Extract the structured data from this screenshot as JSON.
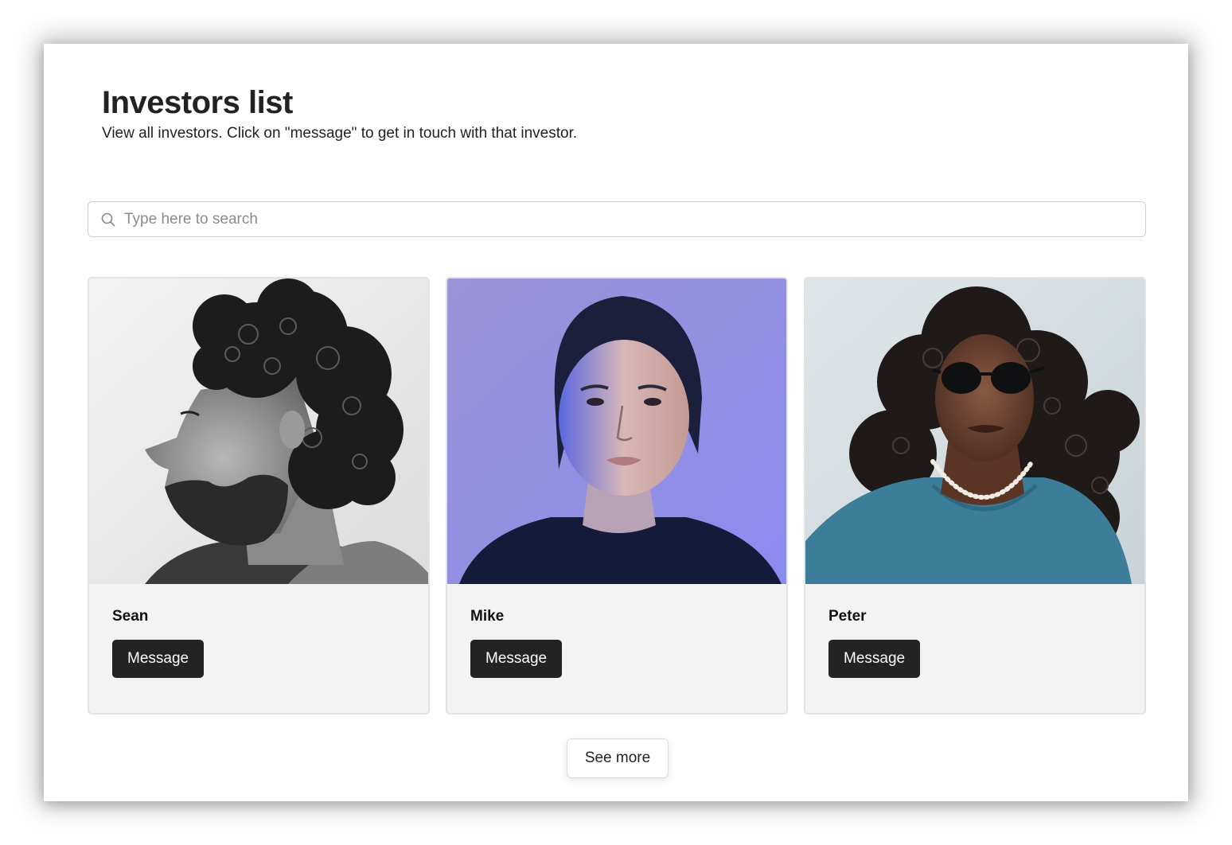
{
  "header": {
    "title": "Investors list",
    "subtitle": "View all investors. Click on \"message\" to get in touch with that investor."
  },
  "search": {
    "placeholder": "Type here to search",
    "icon": "search-icon"
  },
  "investors": [
    {
      "name": "Sean",
      "message_label": "Message",
      "photo_style": "black-and-white profile portrait, curly hair and beard"
    },
    {
      "name": "Mike",
      "message_label": "Message",
      "photo_style": "portrait on purple background, blue lighting"
    },
    {
      "name": "Peter",
      "message_label": "Message",
      "photo_style": "portrait with sunglasses, curly hair, teal t-shirt"
    }
  ],
  "see_more_label": "See more",
  "colors": {
    "button_bg": "#232323",
    "button_text": "#ffffff",
    "card_bg": "#f3f3f3",
    "card_border": "#e2e2e2",
    "title_text": "#222222"
  }
}
